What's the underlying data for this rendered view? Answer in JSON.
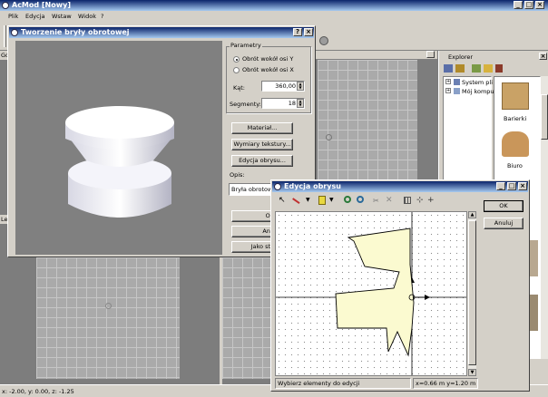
{
  "app": {
    "title": "AcMod [Nowy]"
  },
  "menu": [
    "Plik",
    "Edycja",
    "Wstaw",
    "Widok",
    "?"
  ],
  "views": {
    "top_left": "Gó",
    "bottom_left": "Le"
  },
  "status": {
    "coords": "x: -2.00, y: 0.00, z: -1.25"
  },
  "explorer": {
    "title": "Explorer",
    "tree": [
      "System pli",
      "Mój kompu"
    ],
    "items": [
      "Barierki",
      "Biuro"
    ]
  },
  "dialog_revolve": {
    "title": "Tworzenie bryły obrotowej",
    "params_legend": "Parametry",
    "radio_y": "Obrót wokół osi Y",
    "radio_x": "Obrót wokół osi X",
    "angle_label": "Kąt:",
    "angle_value": "360,00",
    "segments_label": "Segmenty:",
    "segments_value": "18",
    "material_btn": "Materiał...",
    "texture_btn": "Wymiary tekstury...",
    "edit_btn": "Edycja obrysu...",
    "desc_label": "Opis:",
    "desc_value": "Bryła obrotowa",
    "ok_btn": "OK",
    "cancel_btn": "Anu",
    "as_btn": "Jako sta"
  },
  "dialog_outline": {
    "title": "Edycja obrysu",
    "ok_btn": "OK",
    "cancel_btn": "Anuluj",
    "status_hint": "Wybierz elementy do edycji",
    "status_coords": "x=0.66 m  y=1.20 m"
  }
}
